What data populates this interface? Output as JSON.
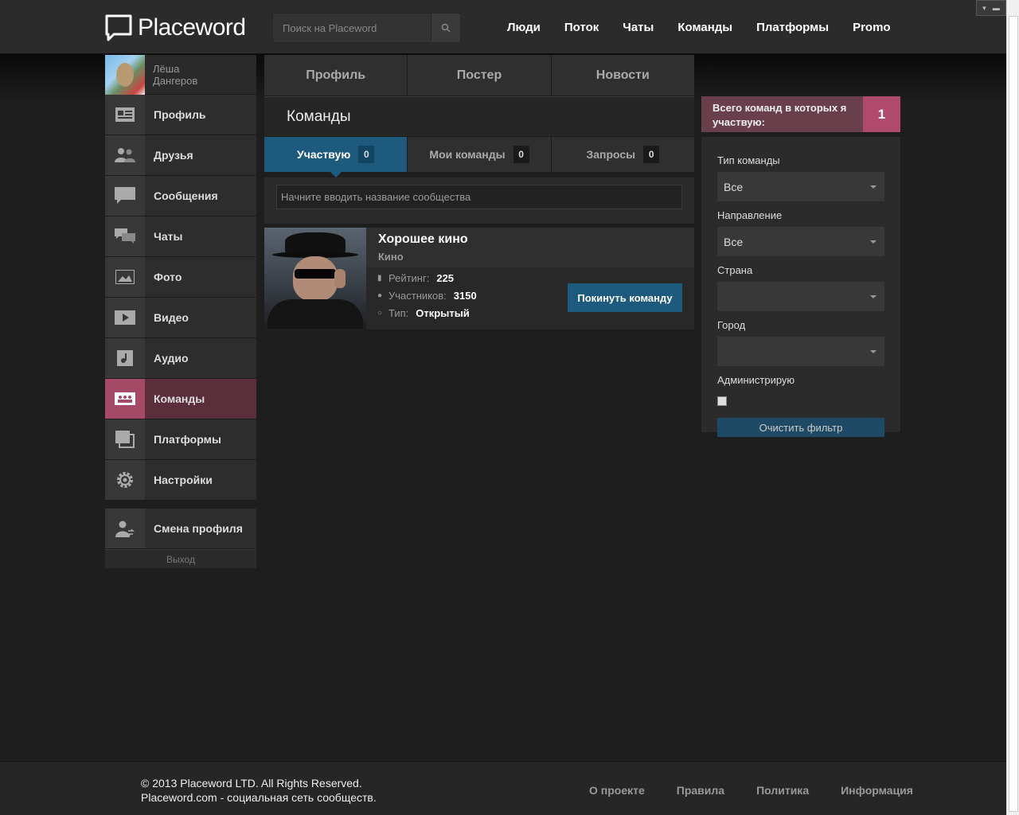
{
  "header": {
    "logo": "Placeword",
    "search_placeholder": "Поиск на Placeword",
    "nav": [
      "Люди",
      "Поток",
      "Чаты",
      "Команды",
      "Платформы",
      "Promo"
    ]
  },
  "user": {
    "first_name": "Лёша",
    "last_name": "Дангеров"
  },
  "sidebar": {
    "items": [
      {
        "label": "Профиль",
        "icon": "profile-card-icon"
      },
      {
        "label": "Друзья",
        "icon": "friends-icon"
      },
      {
        "label": "Сообщения",
        "icon": "message-bubble-icon"
      },
      {
        "label": "Чаты",
        "icon": "chats-icon"
      },
      {
        "label": "Фото",
        "icon": "photo-icon"
      },
      {
        "label": "Видео",
        "icon": "video-play-icon"
      },
      {
        "label": "Аудио",
        "icon": "audio-note-icon"
      },
      {
        "label": "Команды",
        "icon": "teams-icon",
        "active": true
      },
      {
        "label": "Платформы",
        "icon": "platforms-icon"
      },
      {
        "label": "Настройки",
        "icon": "gear-icon"
      }
    ],
    "switch_profile": "Смена профиля",
    "logout": "Выход"
  },
  "main": {
    "top_tabs": [
      "Профиль",
      "Постер",
      "Новости"
    ],
    "section_title": "Команды",
    "sub_tabs": [
      {
        "label": "Участвую",
        "count": "0",
        "active": true
      },
      {
        "label": "Мои команды",
        "count": "0"
      },
      {
        "label": "Запросы",
        "count": "0"
      }
    ],
    "filter_placeholder": "Начните вводить название сообщества",
    "team": {
      "title": "Хорошее кино",
      "category": "Кино",
      "rating_label": "Рейтинг:",
      "rating": "225",
      "members_label": "Участников:",
      "members": "3150",
      "type_label": "Тип:",
      "type": "Открытый",
      "leave_button": "Покинуть команду"
    }
  },
  "right": {
    "total_label": "Всего команд в которых я участвую:",
    "total_count": "1",
    "filters": [
      {
        "label": "Тип команды",
        "value": "Все"
      },
      {
        "label": "Направление",
        "value": "Все"
      },
      {
        "label": "Страна",
        "value": ""
      },
      {
        "label": "Город",
        "value": ""
      }
    ],
    "admin_label": "Администрирую",
    "clear_button": "Очистить фильтр"
  },
  "footer": {
    "copyright_line1": "© 2013 Placeword LTD. All Rights Reserved.",
    "copyright_line2": "Placeword.com - социальная сеть сообществ.",
    "links": [
      "О проекте",
      "Правила",
      "Политика",
      "Информация"
    ]
  },
  "colors": {
    "accent_blue": "#1d5a7e",
    "accent_pink": "#b04a6c",
    "background": "#1e1e1e"
  }
}
